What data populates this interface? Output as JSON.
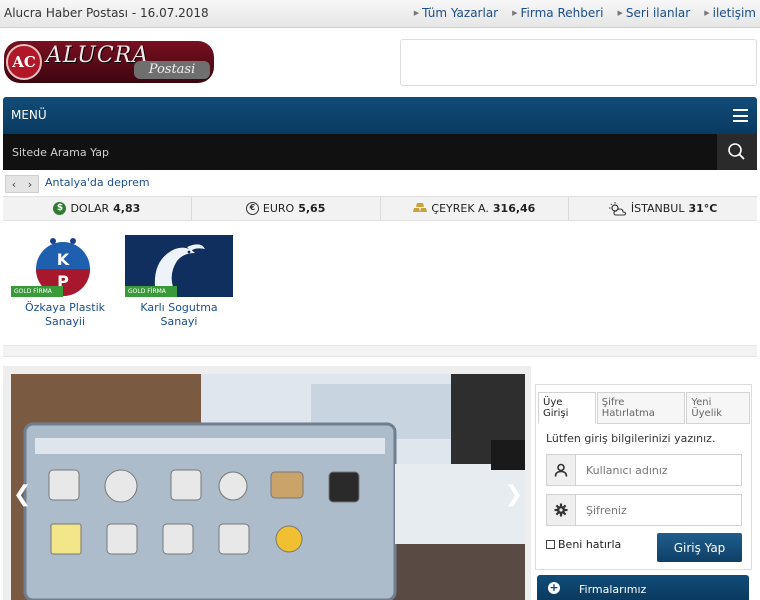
{
  "topbar": {
    "site": "Alucra Haber Postası - 16.07.2018",
    "links": [
      "Tüm Yazarlar",
      "Firma Rehberi",
      "Seri ilanlar",
      "iletişim"
    ]
  },
  "logo": {
    "monogram": "AC",
    "name": "ALUCRA",
    "sub": "Postasi"
  },
  "menu": {
    "label": "MENÜ"
  },
  "search": {
    "placeholder": "Sitede Arama Yap"
  },
  "ticker": {
    "headline": "Antalya'da deprem"
  },
  "stats": [
    {
      "label": "DOLAR",
      "value": "4,83",
      "icon": "dollar-icon"
    },
    {
      "label": "EURO",
      "value": "5,65",
      "icon": "euro-icon"
    },
    {
      "label": "ÇEYREK A.",
      "value": "316,46",
      "icon": "gold-icon"
    },
    {
      "label": "İSTANBUL",
      "value": "31°C",
      "icon": "weather-icon"
    }
  ],
  "firms": [
    {
      "badge": "GOLD FİRMA",
      "logo_letters": "K P",
      "name": "Özkaya Plastik Sanayii"
    },
    {
      "badge": "GOLD FİRMA",
      "name": "Karlı Sogutma Sanayi"
    }
  ],
  "login": {
    "tabs": [
      "Üye Girişi",
      "Şifre Hatırlatma",
      "Yeni Üyelik"
    ],
    "hint": "Lütfen giriş bilgilerinizi yazınız.",
    "username_placeholder": "Kullanıcı adınız",
    "password_placeholder": "Şifreniz",
    "remember": "Beni hatırla",
    "submit": "Giriş Yap"
  },
  "firmbar": {
    "label": "Firmalarımız"
  },
  "colors": {
    "primary": "#114c78",
    "gold_badge": "#3a9a3a",
    "search_bg": "#111111"
  }
}
